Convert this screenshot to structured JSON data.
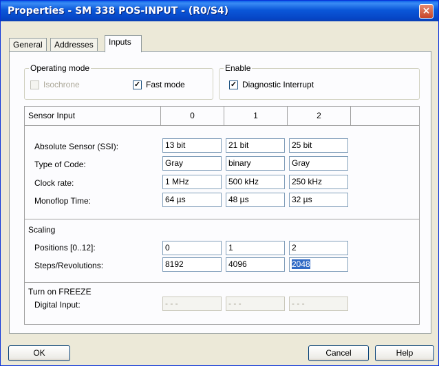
{
  "window": {
    "title": "Properties - SM 338 POS-INPUT - (R0/S4)",
    "close_glyph": "×"
  },
  "tabs": [
    {
      "label": "General",
      "active": false
    },
    {
      "label": "Addresses",
      "active": false
    },
    {
      "label": "Inputs",
      "active": true
    }
  ],
  "operating_mode": {
    "group_label": "Operating mode",
    "isochrone_label": "Isochrone",
    "isochrone_checked": false,
    "isochrone_enabled": false,
    "fast_mode_label": "Fast mode",
    "fast_mode_checked": true
  },
  "enable": {
    "group_label": "Enable",
    "diag_label": "Diagnostic Interrupt",
    "diag_checked": true
  },
  "check_glyph": "✓",
  "table": {
    "header": {
      "label": "Sensor Input",
      "cols": [
        "0",
        "1",
        "2"
      ]
    },
    "rows": [
      {
        "label": "Absolute Sensor (SSI):",
        "values": [
          "13 bit",
          "21 bit",
          "25 bit"
        ]
      },
      {
        "label": "Type of Code:",
        "values": [
          "Gray",
          "binary",
          "Gray"
        ]
      },
      {
        "label": "Clock rate:",
        "values": [
          "1 MHz",
          "500 kHz",
          "250 kHz"
        ]
      },
      {
        "label": "Monoflop Time:",
        "values": [
          "64 µs",
          "48 µs",
          "32 µs"
        ]
      }
    ],
    "scaling": {
      "title": "Scaling",
      "positions_label": "Positions [0..12]:",
      "positions": [
        "0",
        "1",
        "2"
      ],
      "steps_label": "Steps/Revolutions:",
      "steps": [
        "8192",
        "4096",
        "2048"
      ]
    },
    "freeze": {
      "title": "Turn on FREEZE",
      "digital_label": "Digital Input:",
      "digital_values": [
        "- - -",
        "- - -",
        "- - -"
      ]
    }
  },
  "buttons": {
    "ok": "OK",
    "cancel": "Cancel",
    "help": "Help"
  }
}
